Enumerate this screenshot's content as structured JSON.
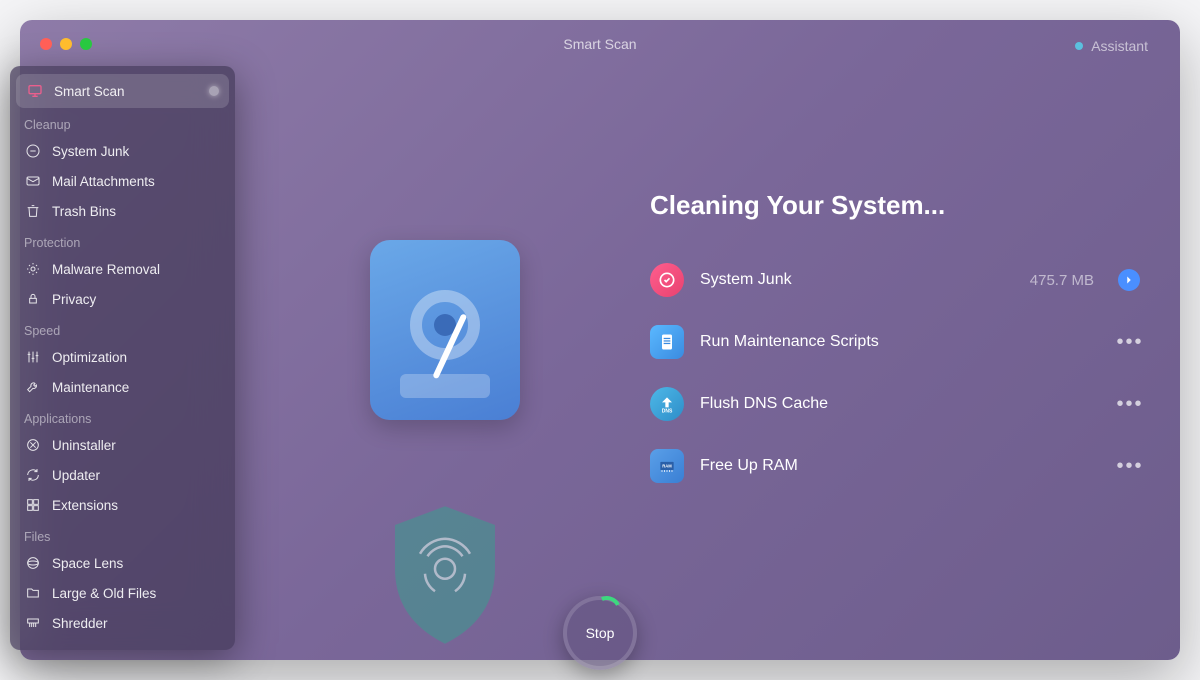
{
  "header": {
    "title": "Smart Scan",
    "assistant": "Assistant"
  },
  "sidebar": {
    "active": {
      "label": "Smart Scan"
    },
    "sections": [
      {
        "title": "Cleanup",
        "items": [
          {
            "label": "System Junk",
            "icon": "system-junk-icon"
          },
          {
            "label": "Mail Attachments",
            "icon": "mail-icon"
          },
          {
            "label": "Trash Bins",
            "icon": "trash-icon"
          }
        ]
      },
      {
        "title": "Protection",
        "items": [
          {
            "label": "Malware Removal",
            "icon": "malware-icon"
          },
          {
            "label": "Privacy",
            "icon": "privacy-icon"
          }
        ]
      },
      {
        "title": "Speed",
        "items": [
          {
            "label": "Optimization",
            "icon": "optimization-icon"
          },
          {
            "label": "Maintenance",
            "icon": "maintenance-icon"
          }
        ]
      },
      {
        "title": "Applications",
        "items": [
          {
            "label": "Uninstaller",
            "icon": "uninstaller-icon"
          },
          {
            "label": "Updater",
            "icon": "updater-icon"
          },
          {
            "label": "Extensions",
            "icon": "extensions-icon"
          }
        ]
      },
      {
        "title": "Files",
        "items": [
          {
            "label": "Space Lens",
            "icon": "space-lens-icon"
          },
          {
            "label": "Large & Old Files",
            "icon": "large-files-icon"
          },
          {
            "label": "Shredder",
            "icon": "shredder-icon"
          }
        ]
      }
    ]
  },
  "main": {
    "heading": "Cleaning Your System...",
    "tasks": [
      {
        "label": "System Junk",
        "value": "475.7 MB",
        "icon": "pink",
        "action": "arrow"
      },
      {
        "label": "Run Maintenance Scripts",
        "value": "",
        "icon": "blue",
        "action": "dots"
      },
      {
        "label": "Flush DNS Cache",
        "value": "",
        "icon": "dns",
        "action": "dots"
      },
      {
        "label": "Free Up RAM",
        "value": "",
        "icon": "ram",
        "action": "dots"
      }
    ],
    "stop": "Stop"
  }
}
